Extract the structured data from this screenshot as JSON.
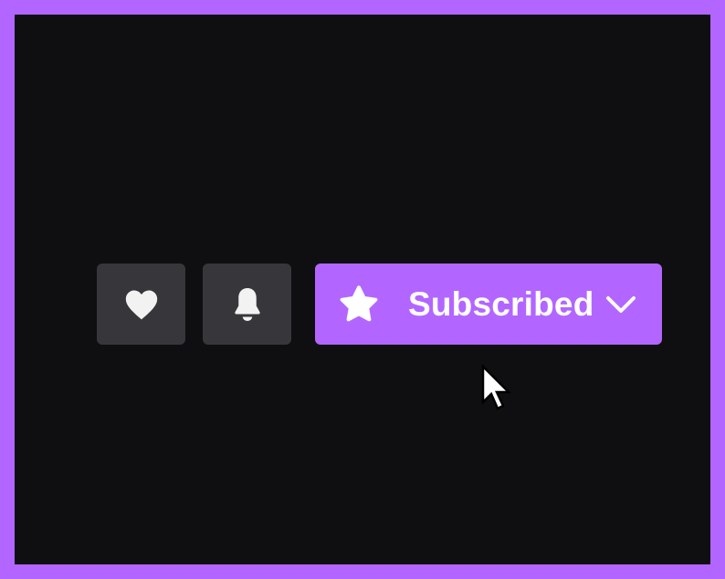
{
  "colors": {
    "frame": "#b266ff",
    "background": "#0f0f11",
    "icon_button_bg": "#37373b",
    "accent": "#b266ff",
    "icon": "#f2f2f2",
    "text": "#ffffff"
  },
  "actions": {
    "follow": {
      "icon": "heart-icon"
    },
    "notifications": {
      "icon": "bell-icon"
    }
  },
  "subscribe": {
    "label": "Subscribed",
    "leading_icon": "star-icon",
    "trailing_icon": "chevron-down-icon",
    "state": "subscribed"
  },
  "pointer": {
    "icon": "mouse-cursor-icon"
  }
}
